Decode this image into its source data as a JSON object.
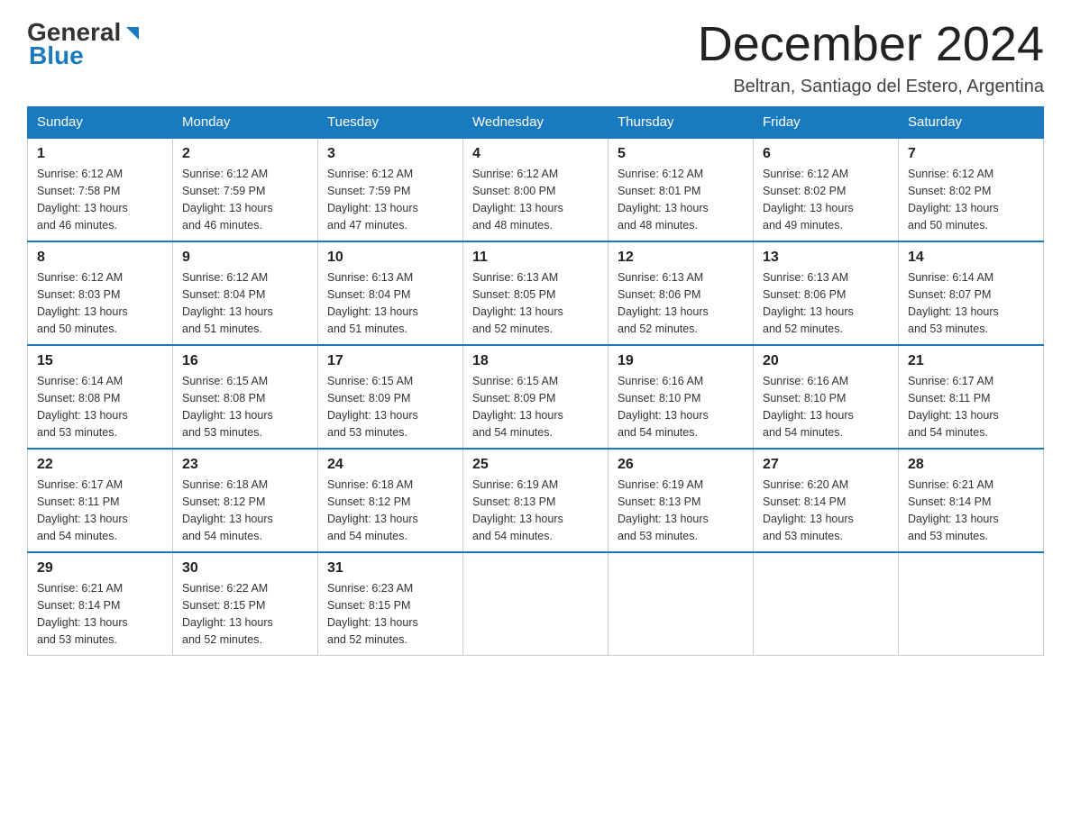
{
  "header": {
    "logo": {
      "general": "General",
      "blue": "Blue"
    },
    "title": "December 2024",
    "subtitle": "Beltran, Santiago del Estero, Argentina"
  },
  "weekdays": [
    "Sunday",
    "Monday",
    "Tuesday",
    "Wednesday",
    "Thursday",
    "Friday",
    "Saturday"
  ],
  "weeks": [
    [
      {
        "day": "1",
        "sunrise": "6:12 AM",
        "sunset": "7:58 PM",
        "daylight": "13 hours and 46 minutes."
      },
      {
        "day": "2",
        "sunrise": "6:12 AM",
        "sunset": "7:59 PM",
        "daylight": "13 hours and 46 minutes."
      },
      {
        "day": "3",
        "sunrise": "6:12 AM",
        "sunset": "7:59 PM",
        "daylight": "13 hours and 47 minutes."
      },
      {
        "day": "4",
        "sunrise": "6:12 AM",
        "sunset": "8:00 PM",
        "daylight": "13 hours and 48 minutes."
      },
      {
        "day": "5",
        "sunrise": "6:12 AM",
        "sunset": "8:01 PM",
        "daylight": "13 hours and 48 minutes."
      },
      {
        "day": "6",
        "sunrise": "6:12 AM",
        "sunset": "8:02 PM",
        "daylight": "13 hours and 49 minutes."
      },
      {
        "day": "7",
        "sunrise": "6:12 AM",
        "sunset": "8:02 PM",
        "daylight": "13 hours and 50 minutes."
      }
    ],
    [
      {
        "day": "8",
        "sunrise": "6:12 AM",
        "sunset": "8:03 PM",
        "daylight": "13 hours and 50 minutes."
      },
      {
        "day": "9",
        "sunrise": "6:12 AM",
        "sunset": "8:04 PM",
        "daylight": "13 hours and 51 minutes."
      },
      {
        "day": "10",
        "sunrise": "6:13 AM",
        "sunset": "8:04 PM",
        "daylight": "13 hours and 51 minutes."
      },
      {
        "day": "11",
        "sunrise": "6:13 AM",
        "sunset": "8:05 PM",
        "daylight": "13 hours and 52 minutes."
      },
      {
        "day": "12",
        "sunrise": "6:13 AM",
        "sunset": "8:06 PM",
        "daylight": "13 hours and 52 minutes."
      },
      {
        "day": "13",
        "sunrise": "6:13 AM",
        "sunset": "8:06 PM",
        "daylight": "13 hours and 52 minutes."
      },
      {
        "day": "14",
        "sunrise": "6:14 AM",
        "sunset": "8:07 PM",
        "daylight": "13 hours and 53 minutes."
      }
    ],
    [
      {
        "day": "15",
        "sunrise": "6:14 AM",
        "sunset": "8:08 PM",
        "daylight": "13 hours and 53 minutes."
      },
      {
        "day": "16",
        "sunrise": "6:15 AM",
        "sunset": "8:08 PM",
        "daylight": "13 hours and 53 minutes."
      },
      {
        "day": "17",
        "sunrise": "6:15 AM",
        "sunset": "8:09 PM",
        "daylight": "13 hours and 53 minutes."
      },
      {
        "day": "18",
        "sunrise": "6:15 AM",
        "sunset": "8:09 PM",
        "daylight": "13 hours and 54 minutes."
      },
      {
        "day": "19",
        "sunrise": "6:16 AM",
        "sunset": "8:10 PM",
        "daylight": "13 hours and 54 minutes."
      },
      {
        "day": "20",
        "sunrise": "6:16 AM",
        "sunset": "8:10 PM",
        "daylight": "13 hours and 54 minutes."
      },
      {
        "day": "21",
        "sunrise": "6:17 AM",
        "sunset": "8:11 PM",
        "daylight": "13 hours and 54 minutes."
      }
    ],
    [
      {
        "day": "22",
        "sunrise": "6:17 AM",
        "sunset": "8:11 PM",
        "daylight": "13 hours and 54 minutes."
      },
      {
        "day": "23",
        "sunrise": "6:18 AM",
        "sunset": "8:12 PM",
        "daylight": "13 hours and 54 minutes."
      },
      {
        "day": "24",
        "sunrise": "6:18 AM",
        "sunset": "8:12 PM",
        "daylight": "13 hours and 54 minutes."
      },
      {
        "day": "25",
        "sunrise": "6:19 AM",
        "sunset": "8:13 PM",
        "daylight": "13 hours and 54 minutes."
      },
      {
        "day": "26",
        "sunrise": "6:19 AM",
        "sunset": "8:13 PM",
        "daylight": "13 hours and 53 minutes."
      },
      {
        "day": "27",
        "sunrise": "6:20 AM",
        "sunset": "8:14 PM",
        "daylight": "13 hours and 53 minutes."
      },
      {
        "day": "28",
        "sunrise": "6:21 AM",
        "sunset": "8:14 PM",
        "daylight": "13 hours and 53 minutes."
      }
    ],
    [
      {
        "day": "29",
        "sunrise": "6:21 AM",
        "sunset": "8:14 PM",
        "daylight": "13 hours and 53 minutes."
      },
      {
        "day": "30",
        "sunrise": "6:22 AM",
        "sunset": "8:15 PM",
        "daylight": "13 hours and 52 minutes."
      },
      {
        "day": "31",
        "sunrise": "6:23 AM",
        "sunset": "8:15 PM",
        "daylight": "13 hours and 52 minutes."
      },
      null,
      null,
      null,
      null
    ]
  ],
  "labels": {
    "sunrise": "Sunrise:",
    "sunset": "Sunset:",
    "daylight": "Daylight:"
  }
}
